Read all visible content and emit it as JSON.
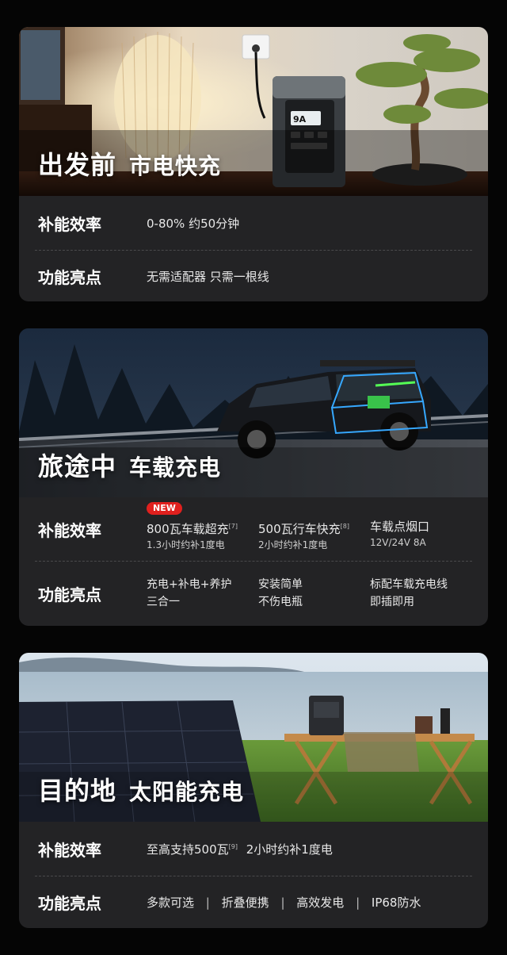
{
  "card1": {
    "title": "出发前",
    "subtitle": "市电快充",
    "device_display": "9A",
    "rows": [
      {
        "label": "补能效率",
        "value": "0-80% 约50分钟"
      },
      {
        "label": "功能亮点",
        "value": "无需适配器 只需一根线"
      }
    ]
  },
  "card2": {
    "title": "旅途中",
    "subtitle": "车载充电",
    "rows": {
      "efficiency_label": "补能效率",
      "badge": "NEW",
      "efficiency": [
        {
          "title": "800瓦车载超充",
          "ref": "[7]",
          "sub": "1.3小时约补1度电"
        },
        {
          "title": "500瓦行车快充",
          "ref": "[8]",
          "sub": "2小时约补1度电"
        },
        {
          "title": "车载点烟口",
          "ref": "",
          "sub": "12V/24V 8A"
        }
      ],
      "features_label": "功能亮点",
      "features": [
        {
          "line1": "充电+补电+养护",
          "line2": "三合一"
        },
        {
          "line1": "安装简单",
          "line2": "不伤电瓶"
        },
        {
          "line1": "标配车载充电线",
          "line2": "即插即用"
        }
      ]
    }
  },
  "card3": {
    "title": "目的地",
    "subtitle": "太阳能充电",
    "efficiency_label": "补能效率",
    "efficiency_value": "至高支持500瓦",
    "efficiency_ref": "[9]",
    "efficiency_tail": "2小时约补1度电",
    "features_label": "功能亮点",
    "features": [
      "多款可选",
      "折叠便携",
      "高效发电",
      "IP68防水"
    ],
    "features_separator": "|"
  }
}
